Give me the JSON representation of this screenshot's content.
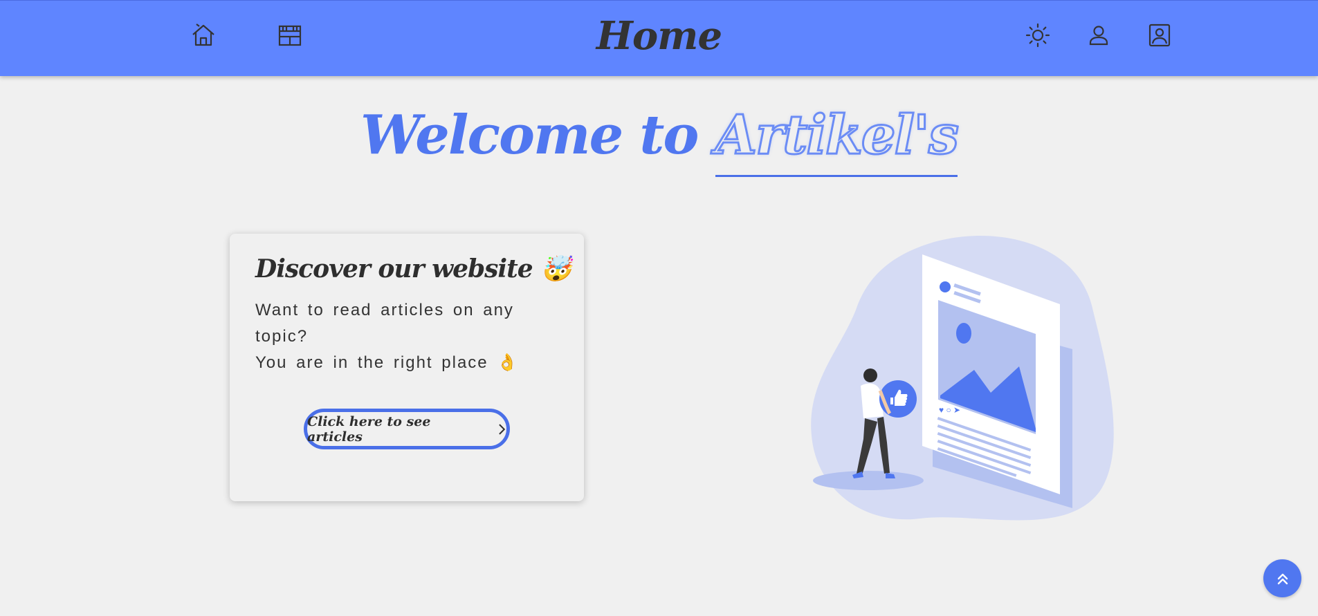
{
  "header": {
    "title": "Home",
    "icons": {
      "home": "home-icon",
      "articles": "articles-icon",
      "theme": "sun-icon",
      "user": "user-icon",
      "profile": "profile-card-icon"
    }
  },
  "welcome": {
    "prefix": "Welcome to",
    "brand": "Artikel's"
  },
  "card": {
    "title": "Discover our website",
    "title_emoji": "🤯",
    "text_line1": "Want to read articles on any topic?",
    "text_line2": "You are in the right place",
    "text_emoji": "👌",
    "button_label": "Click here to see articles"
  },
  "colors": {
    "header_bg": "#5f85ff",
    "accent": "#5077f0",
    "background": "#f0f0f0",
    "text_dark": "#2e2e2e"
  }
}
